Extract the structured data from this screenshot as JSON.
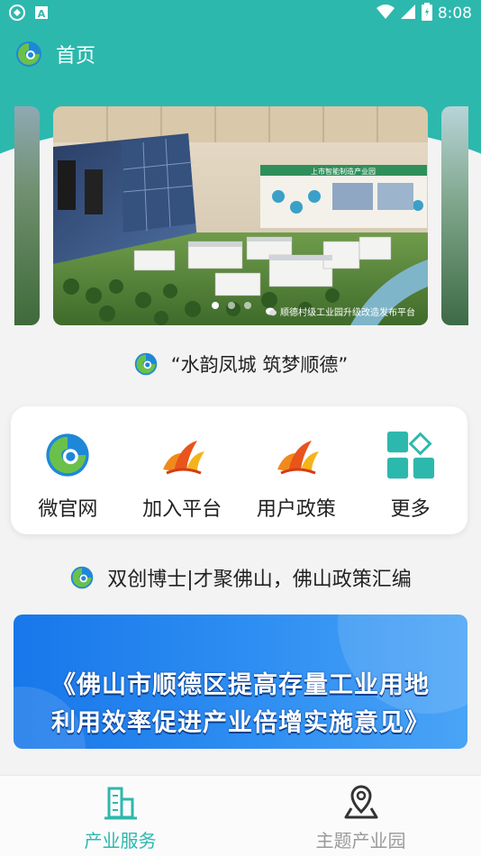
{
  "status_bar": {
    "time": "8:08",
    "icons": [
      "sync-icon",
      "a-notification-icon",
      "wifi-icon",
      "cellular-icon",
      "battery-icon"
    ]
  },
  "appbar": {
    "title": "首页",
    "logo": "app-logo-icon"
  },
  "carousel": {
    "caption": "顺德村级工业园升级改造发布平台",
    "sign_text": "上市智能制造产业园",
    "dot_count": 3,
    "active_dot": 0
  },
  "slogan": {
    "text": "“水韵凤城 筑梦顺德”"
  },
  "menu": {
    "items": [
      {
        "label": "微官网",
        "icon": "swirl-logo-icon"
      },
      {
        "label": "加入平台",
        "icon": "phoenix-icon"
      },
      {
        "label": "用户政策",
        "icon": "phoenix-icon"
      },
      {
        "label": "更多",
        "icon": "grid-more-icon"
      }
    ]
  },
  "policy": {
    "headline": "双创博士|才聚佛山，佛山政策汇编"
  },
  "banner": {
    "line1": "《佛山市顺德区提高存量工业用地",
    "line2": "利用效率促进产业倍增实施意见》"
  },
  "bottom_nav": {
    "items": [
      {
        "label": "产业服务",
        "icon": "buildings-icon",
        "active": true
      },
      {
        "label": "主题产业园",
        "icon": "map-pin-icon",
        "active": false
      }
    ]
  },
  "colors": {
    "primary": "#2db8ad",
    "banner_blue": "#1877ea",
    "inactive": "#9a9a9a"
  }
}
